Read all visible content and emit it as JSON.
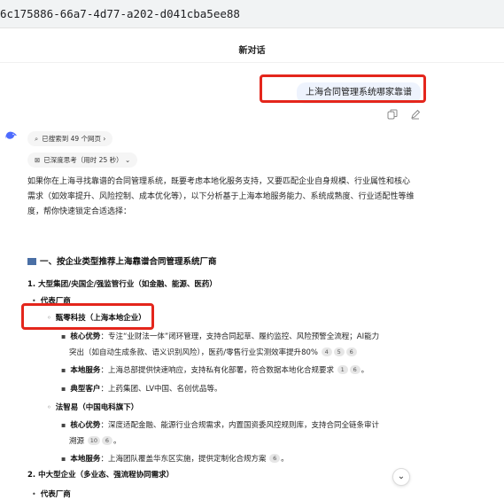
{
  "browser": {
    "url_fragment": "6c175886-66a7-4d77-a202-d041cba5ee88"
  },
  "chat": {
    "title": "新对话",
    "user_message": "上海合同管理系统哪家靠谱",
    "copy_icon": "copy-icon",
    "edit_icon": "edit-icon"
  },
  "assistant": {
    "avatar_icon": "whale-logo-icon",
    "search_chip": "已搜索到 49 个网页",
    "search_chip_arrow": "›",
    "think_chip": "已深度思考（用时 25 秒）",
    "think_chip_arrow": "⌄",
    "intro": "如果你在上海寻找靠谱的合同管理系统，既要考虑本地化服务支持，又要匹配企业自身规模、行业属性和核心需求（如效率提升、风险控制、成本优化等），以下分析基于上海本地服务能力、系统成熟度、行业适配性等维度，帮你快速锁定合适选择：",
    "section1": "一、按企业类型推荐上海靠谱合同管理系统厂商",
    "sub1": "1. 大型集团/央国企/强监管行业（如金融、能源、医药）",
    "vendors_label": "代表厂商",
    "vendor1": {
      "name": "甄零科技（上海本地企业）",
      "core_label": "核心优势",
      "core_text": "：专注“业财法一体”闭环管理，支持合同起草、履约监控、风险预警全流程；AI能力",
      "core_text2": "突出（如自动生成条款、语义识别风险），医药/零售行业实测效率提升80%",
      "core_cites": [
        "4",
        "5",
        "6"
      ],
      "local_label": "本地服务",
      "local_text": "：上海总部提供快速响应，支持私有化部署，符合数据本地化合规要求",
      "local_cites": [
        "1",
        "6"
      ],
      "client_label": "典型客户",
      "client_text": "：上药集团、LV中国、名创优品等。"
    },
    "vendor2": {
      "name": "法智易（中国电科旗下）",
      "core_label": "核心优势",
      "core_text": "：深度适配金融、能源行业合规需求，内置国资委风控规则库，支持合同全链条审计",
      "core_text2": "溯源",
      "core_cites": [
        "10",
        "6"
      ],
      "local_label": "本地服务",
      "local_text": "：上海团队覆盖华东区实施，提供定制化合规方案",
      "local_cites": [
        "6"
      ]
    },
    "sub2": "2. 中大型企业（多业态、强流程协同需求）",
    "vendors_label2": "代表厂商"
  },
  "controls": {
    "scroll_down": "⌄"
  }
}
